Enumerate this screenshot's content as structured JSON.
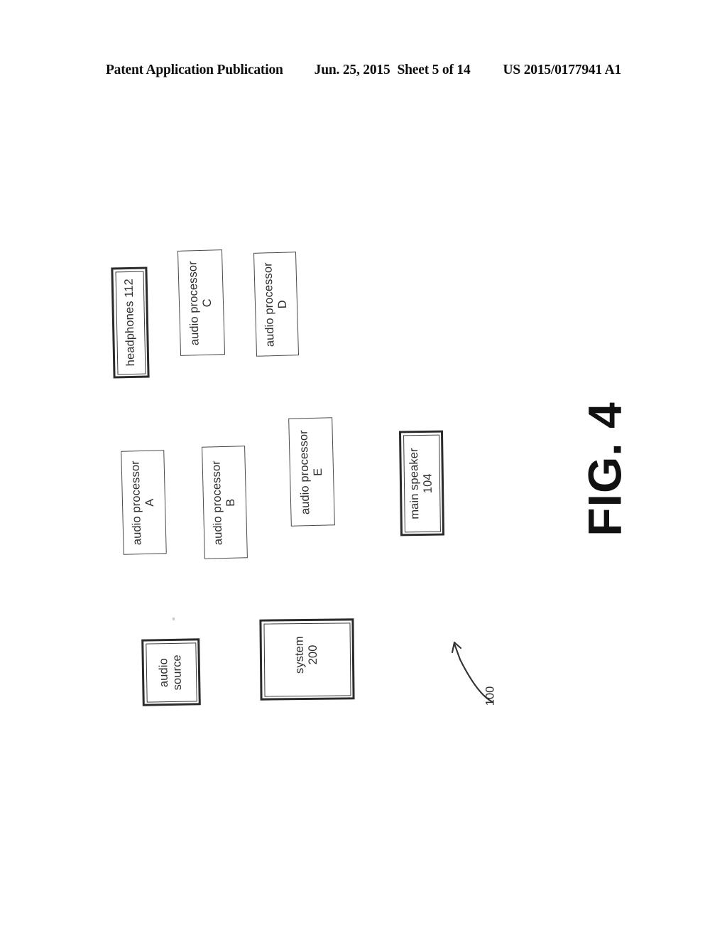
{
  "header": {
    "publication": "Patent Application Publication",
    "date": "Jun. 25, 2015",
    "sheet": "Sheet 5 of 14",
    "patent_number": "US 2015/0177941 A1"
  },
  "figure": {
    "title": "FIG. 4",
    "reference_numeral": "100",
    "blocks": [
      {
        "id": "headphones",
        "line1": "headphones 112",
        "line2": "",
        "border": "heavy"
      },
      {
        "id": "audio-processor-c",
        "line1": "audio processor",
        "line2": "C",
        "border": "thin"
      },
      {
        "id": "audio-processor-d",
        "line1": "audio processor",
        "line2": "D",
        "border": "thin"
      },
      {
        "id": "audio-processor-a",
        "line1": "audio processor",
        "line2": "A",
        "border": "thin"
      },
      {
        "id": "audio-processor-b",
        "line1": "audio processor",
        "line2": "B",
        "border": "thin"
      },
      {
        "id": "audio-processor-e",
        "line1": "audio processor",
        "line2": "E",
        "border": "thin"
      },
      {
        "id": "main-speaker",
        "line1": "main speaker",
        "line2": "104",
        "border": "heavy"
      },
      {
        "id": "audio-source",
        "line1": "audio",
        "line2": "source",
        "border": "heavy"
      },
      {
        "id": "system",
        "line1": "system",
        "line2": "200",
        "border": "heavy"
      }
    ]
  },
  "colors": {
    "ink": "#2e2e2e",
    "heavy_border": "#2b2b2b",
    "thin_border": "#4a4a4a",
    "page_background": "#ffffff"
  }
}
